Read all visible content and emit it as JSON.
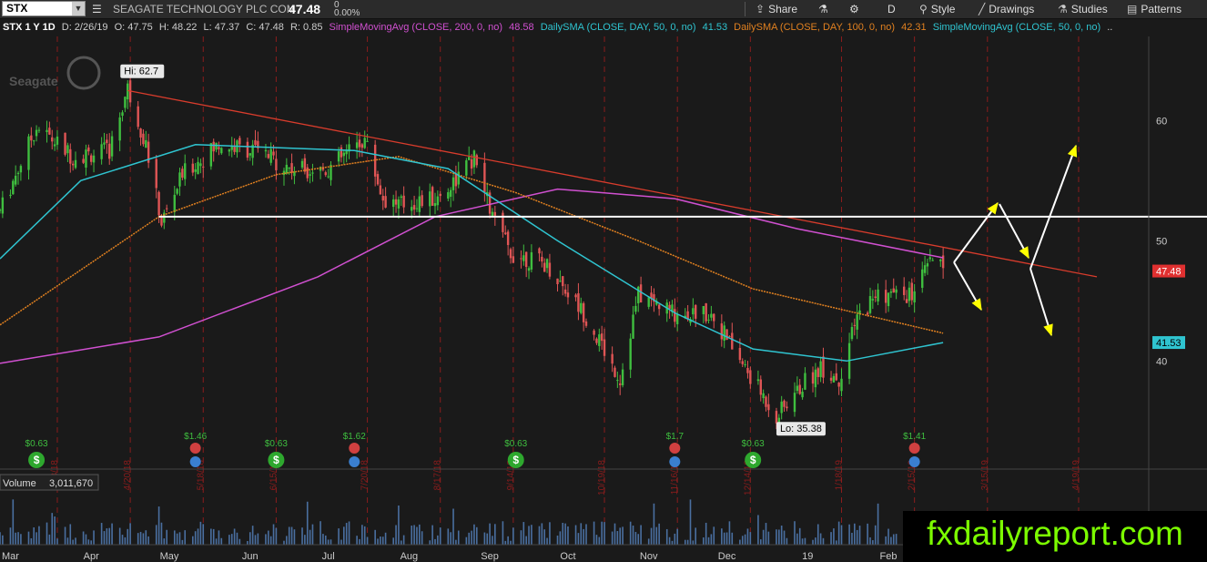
{
  "toolbar": {
    "symbol": "STX",
    "company": "SEAGATE TECHNOLOGY PLC COM",
    "price": "47.48",
    "change_top": "0",
    "change_pct": "0.00%",
    "share": "Share",
    "interval": "D",
    "style": "Style",
    "drawings": "Drawings",
    "studies": "Studies",
    "patterns": "Patterns"
  },
  "infobar": {
    "label": "STX 1 Y 1D",
    "date": "D: 2/26/19",
    "open": "O: 47.75",
    "high": "H: 48.22",
    "low": "L: 47.37",
    "close": "C: 47.48",
    "range": "R: 0.85",
    "study1": "SimpleMovingAvg (CLOSE, 200, 0, no)",
    "study1_val": "48.58",
    "study2": "DailySMA (CLOSE, DAY, 50, 0, no)",
    "study2_val": "41.53",
    "study3": "DailySMA (CLOSE, DAY, 100, 0, no)",
    "study3_val": "42.31",
    "study4": "SimpleMovingAvg (CLOSE, 50, 0, no)",
    "more": ".."
  },
  "colors": {
    "up": "#3fbf3f",
    "down": "#e05555",
    "sma200": "#d050d0",
    "sma50": "#2fc4d0",
    "sma100": "#e08020",
    "trendline": "#d83c2c",
    "support": "#ffffff",
    "arrows": "#ffff00",
    "month_line": "#8a1c1c"
  },
  "chart_data": {
    "type": "candlestick",
    "symbol": "STX",
    "ylim": [
      31,
      67
    ],
    "price_ticks": [
      40,
      50,
      60
    ],
    "last_price": 47.48,
    "sma50_last": 41.53,
    "high_label": "Hi: 62.7",
    "low_label": "Lo: 35.38",
    "x_labels": [
      "Mar",
      "Apr",
      "May",
      "Jun",
      "Jul",
      "Aug",
      "Sep",
      "Oct",
      "Nov",
      "Dec",
      "19",
      "Feb"
    ],
    "date_labels": [
      "3/23/18",
      "4/20/18",
      "5/18/18",
      "6/15/18",
      "7/20/18",
      "8/17/18",
      "9/14/18",
      "10/19/18",
      "11/16/18",
      "12/14/18",
      "1/18/19",
      "2/15/19",
      "3/15/19",
      "4/19/19"
    ],
    "events": [
      {
        "type": "dividend",
        "label": "$0.63",
        "date": "2018-03"
      },
      {
        "type": "earnings",
        "label": "$1.46",
        "date": "2018-05"
      },
      {
        "type": "dividend",
        "label": "$0.63",
        "date": "2018-06"
      },
      {
        "type": "earnings",
        "label": "$1.62",
        "date": "2018-07"
      },
      {
        "type": "dividend",
        "label": "$0.63",
        "date": "2018-09"
      },
      {
        "type": "earnings",
        "label": "$1.7",
        "date": "2018-11"
      },
      {
        "type": "dividend",
        "label": "$0.63",
        "date": "2018-12"
      },
      {
        "type": "earnings",
        "label": "$1.41",
        "date": "2019-02"
      }
    ],
    "volume_label": "Volume",
    "volume_value": "3,011,670",
    "key_prices": [
      {
        "date": "2018-03-01",
        "close": 52.5
      },
      {
        "date": "2018-03-15",
        "close": 59.5
      },
      {
        "date": "2018-03-29",
        "close": 57.0
      },
      {
        "date": "2018-04-12",
        "close": 57.5
      },
      {
        "date": "2018-04-19",
        "close": 62.7
      },
      {
        "date": "2018-04-26",
        "close": 58.0
      },
      {
        "date": "2018-05-02",
        "close": 51.5
      },
      {
        "date": "2018-05-10",
        "close": 55.5
      },
      {
        "date": "2018-05-24",
        "close": 58.0
      },
      {
        "date": "2018-06-07",
        "close": 57.5
      },
      {
        "date": "2018-06-21",
        "close": 56.0
      },
      {
        "date": "2018-07-05",
        "close": 56.0
      },
      {
        "date": "2018-07-19",
        "close": 58.5
      },
      {
        "date": "2018-07-26",
        "close": 53.5
      },
      {
        "date": "2018-08-02",
        "close": 53.0
      },
      {
        "date": "2018-08-16",
        "close": 53.5
      },
      {
        "date": "2018-08-30",
        "close": 56.8
      },
      {
        "date": "2018-09-06",
        "close": 52.0
      },
      {
        "date": "2018-09-13",
        "close": 49.0
      },
      {
        "date": "2018-09-27",
        "close": 48.0
      },
      {
        "date": "2018-10-11",
        "close": 44.0
      },
      {
        "date": "2018-10-25",
        "close": 38.5
      },
      {
        "date": "2018-11-01",
        "close": 45.5
      },
      {
        "date": "2018-11-15",
        "close": 44.0
      },
      {
        "date": "2018-11-29",
        "close": 44.0
      },
      {
        "date": "2018-12-13",
        "close": 39.0
      },
      {
        "date": "2018-12-24",
        "close": 35.4
      },
      {
        "date": "2019-01-03",
        "close": 38.0
      },
      {
        "date": "2019-01-10",
        "close": 39.5
      },
      {
        "date": "2019-01-17",
        "close": 38.5
      },
      {
        "date": "2019-01-24",
        "close": 43.5
      },
      {
        "date": "2019-01-31",
        "close": 45.5
      },
      {
        "date": "2019-02-14",
        "close": 45.5
      },
      {
        "date": "2019-02-22",
        "close": 48.5
      },
      {
        "date": "2019-02-26",
        "close": 47.48
      }
    ],
    "sma200_points": [
      {
        "date": "2018-03-01",
        "value": 39.8
      },
      {
        "date": "2018-05-01",
        "value": 42.0
      },
      {
        "date": "2018-07-01",
        "value": 47.0
      },
      {
        "date": "2018-08-15",
        "value": 52.0
      },
      {
        "date": "2018-10-01",
        "value": 54.3
      },
      {
        "date": "2018-11-15",
        "value": 53.5
      },
      {
        "date": "2019-01-01",
        "value": 51.0
      },
      {
        "date": "2019-02-26",
        "value": 48.58
      }
    ],
    "sma100_points": [
      {
        "date": "2018-03-01",
        "value": 43.0
      },
      {
        "date": "2018-05-01",
        "value": 52.0
      },
      {
        "date": "2018-06-15",
        "value": 55.5
      },
      {
        "date": "2018-08-01",
        "value": 57.0
      },
      {
        "date": "2018-09-15",
        "value": 54.0
      },
      {
        "date": "2018-11-01",
        "value": 50.0
      },
      {
        "date": "2018-12-15",
        "value": 46.0
      },
      {
        "date": "2019-02-26",
        "value": 42.31
      }
    ],
    "sma50_points": [
      {
        "date": "2018-03-01",
        "value": 48.5
      },
      {
        "date": "2018-04-01",
        "value": 55.0
      },
      {
        "date": "2018-05-15",
        "value": 58.0
      },
      {
        "date": "2018-07-15",
        "value": 57.5
      },
      {
        "date": "2018-08-20",
        "value": 56.0
      },
      {
        "date": "2018-10-01",
        "value": 50.0
      },
      {
        "date": "2018-11-15",
        "value": 44.0
      },
      {
        "date": "2018-12-15",
        "value": 41.0
      },
      {
        "date": "2019-01-20",
        "value": 40.0
      },
      {
        "date": "2019-02-26",
        "value": 41.53
      }
    ],
    "trendline": {
      "start": {
        "date": "2018-04-19",
        "value": 62.5
      },
      "end": {
        "date": "2019-04-26",
        "value": 47.0
      }
    },
    "support_level": 52.0
  },
  "watermark": "fxdailyreport.com"
}
